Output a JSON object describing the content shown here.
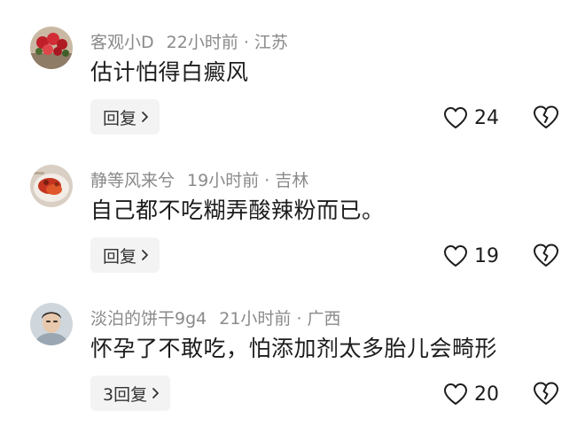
{
  "comments": [
    {
      "username": "客观小D",
      "time": "22小时前",
      "location": "江苏",
      "text": "估计怕得白癜风",
      "reply_label": "回复",
      "likes": "24",
      "avatar_icon": "flower-bouquet-avatar"
    },
    {
      "username": "静等风来兮",
      "time": "19小时前",
      "location": "吉林",
      "text": "自己都不吃糊弄酸辣粉而已。",
      "reply_label": "回复",
      "likes": "19",
      "avatar_icon": "food-plate-avatar"
    },
    {
      "username": "淡泊的饼干9g4",
      "time": "21小时前",
      "location": "广西",
      "text": "怀孕了不敢吃，怕添加剂太多胎儿会畸形",
      "reply_label": "3回复",
      "likes": "20",
      "avatar_icon": "person-photo-avatar"
    }
  ],
  "meta_separator": "·",
  "colors": {
    "meta_text": "#8a8a8a",
    "body_text": "#1c1c1c",
    "reply_bg": "#f3f3f3"
  }
}
